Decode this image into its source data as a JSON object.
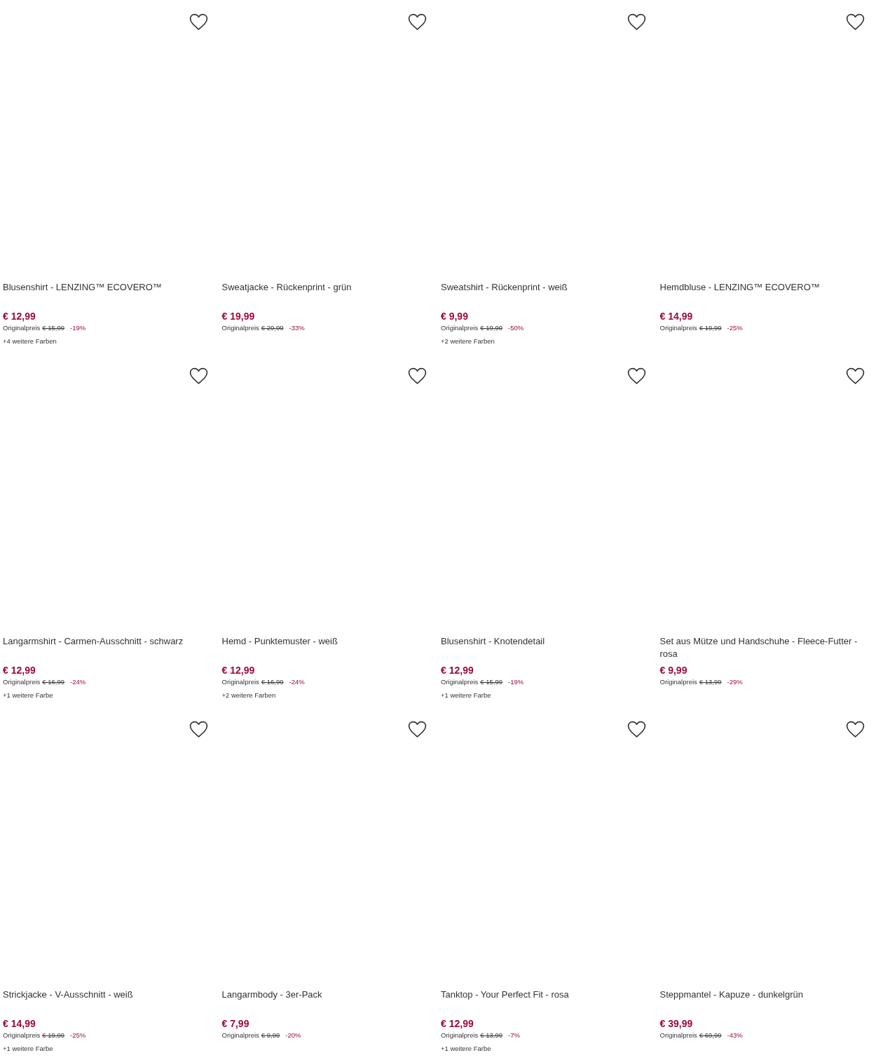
{
  "products": [
    {
      "title": "Blusenshirt - LENZING™ ECOVERO™",
      "price": "€ 12,99",
      "original_label": "Originalpreis",
      "original_price": "€ 15,99",
      "discount": "-19%",
      "more_colors": "+4 weitere Farben",
      "favorite": false
    },
    {
      "title": "Sweatjacke - Rückenprint - grün",
      "price": "€ 19,99",
      "original_label": "Originalpreis",
      "original_price": "€ 29,99",
      "discount": "-33%",
      "favorite": false
    },
    {
      "title": "Sweatshirt - Rückenprint - weiß",
      "price": "€ 9,99",
      "original_label": "Originalpreis",
      "original_price": "€ 19,99",
      "discount": "-50%",
      "more_colors": "+2 weitere Farben",
      "favorite": false
    },
    {
      "title": "Hemdbluse - LENZING™ ECOVERO™",
      "price": "€ 14,99",
      "original_label": "Originalpreis",
      "original_price": "€ 19,99",
      "discount": "-25%",
      "favorite": false
    },
    {
      "title": "Langarmshirt - Carmen-Ausschnitt - schwarz",
      "price": "€ 12,99",
      "original_label": "Originalpreis",
      "original_price": "€ 16,99",
      "discount": "-24%",
      "more_colors": "+1 weitere Farbe",
      "favorite": false
    },
    {
      "title": "Hemd - Punktemuster - weiß",
      "price": "€ 12,99",
      "original_label": "Originalpreis",
      "original_price": "€ 16,99",
      "discount": "-24%",
      "more_colors": "+2 weitere Farben",
      "favorite": false
    },
    {
      "title": "Blusenshirt - Knotendetail",
      "price": "€ 12,99",
      "original_label": "Originalpreis",
      "original_price": "€ 15,99",
      "discount": "-19%",
      "more_colors": "+1 weitere Farbe",
      "favorite": false
    },
    {
      "title": "Set aus Mütze und Handschuhe - Fleece-Futter - rosa",
      "price": "€ 9,99",
      "original_label": "Originalpreis",
      "original_price": "€ 13,99",
      "discount": "-29%",
      "favorite": false
    },
    {
      "title": "Strickjacke - V-Ausschnitt - weiß",
      "price": "€ 14,99",
      "original_label": "Originalpreis",
      "original_price": "€ 19,99",
      "discount": "-25%",
      "more_colors": "+1 weitere Farbe",
      "favorite": false
    },
    {
      "title": "Langarmbody - 3er-Pack",
      "price": "€ 7,99",
      "original_label": "Originalpreis",
      "original_price": "€ 9,99",
      "discount": "-20%",
      "favorite": false
    },
    {
      "title": "Tanktop - Your Perfect Fit - rosa",
      "price": "€ 12,99",
      "original_label": "Originalpreis",
      "original_price": "€ 13,99",
      "discount": "-7%",
      "more_colors": "+1 weitere Farbe",
      "favorite": false
    },
    {
      "title": "Steppmantel - Kapuze - dunkelgrün",
      "price": "€ 39,99",
      "original_label": "Originalpreis",
      "original_price": "€ 69,99",
      "discount": "-43%",
      "favorite": false
    }
  ]
}
